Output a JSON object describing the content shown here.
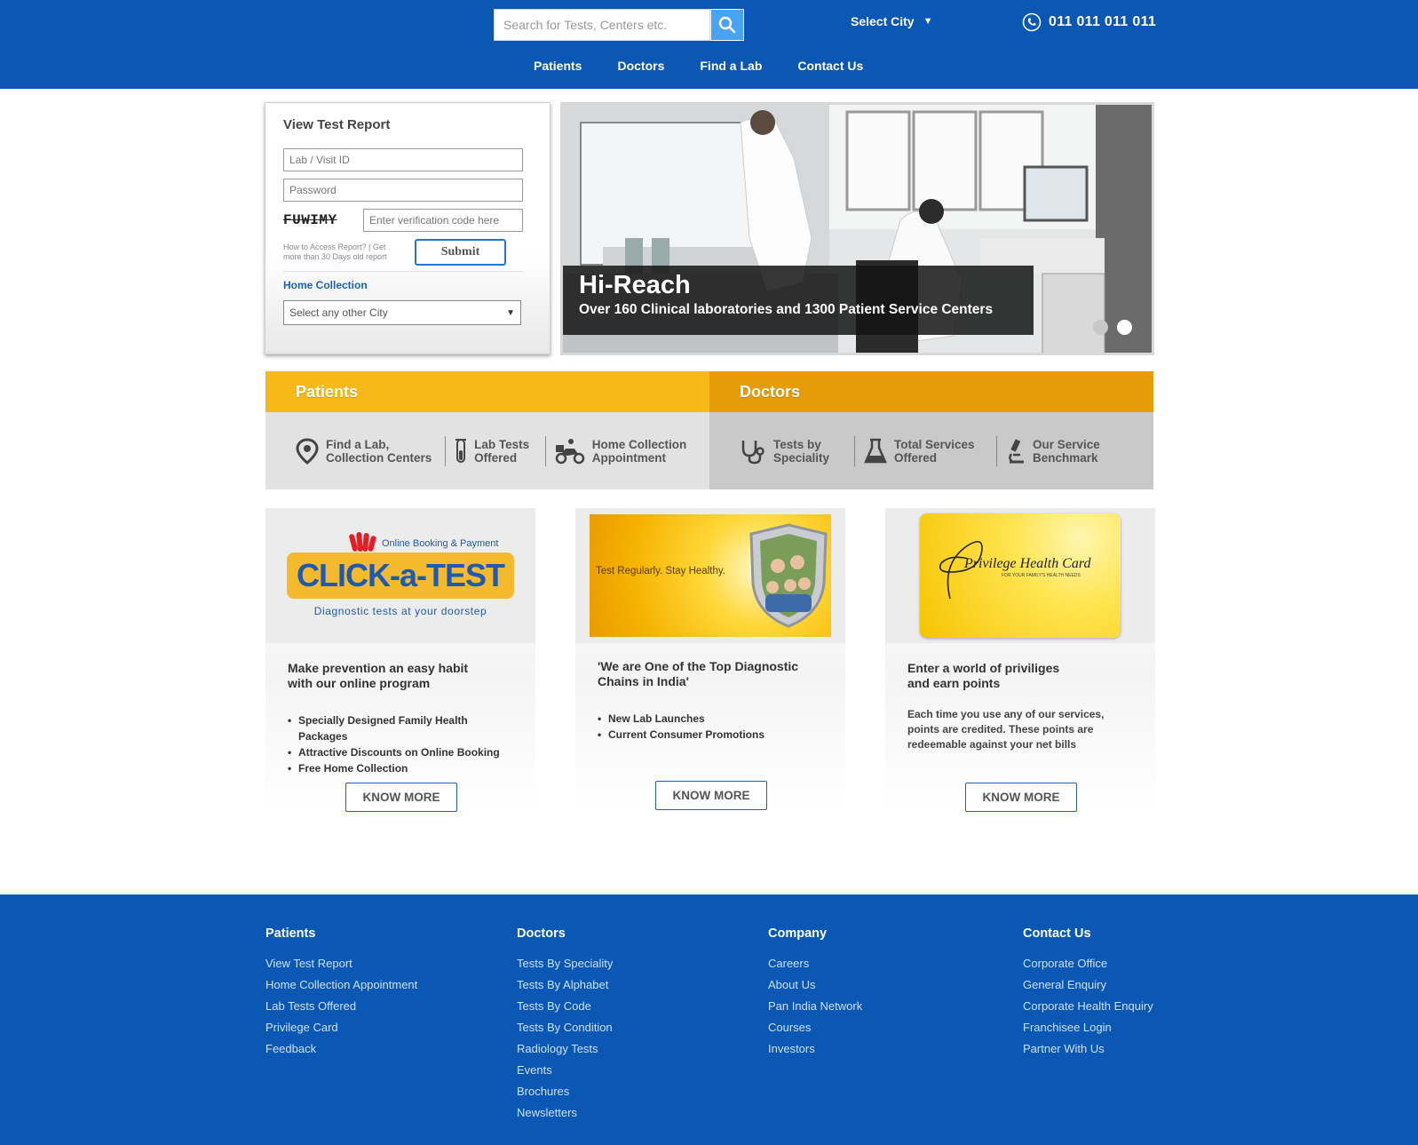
{
  "header": {
    "search_placeholder": "Search for Tests, Centers etc.",
    "city_label": "Select City",
    "phone": "011 011 011 011",
    "nav": [
      "Patients",
      "Doctors",
      "Find a Lab",
      "Contact Us"
    ]
  },
  "login": {
    "title": "View Test Report",
    "lab_id_placeholder": "Lab / Visit ID",
    "password_placeholder": "Password",
    "captcha_text": "FUWIMY",
    "captcha_placeholder": "Enter verification code here",
    "help_text": "How to Access Report? | Get more than 30 Days old report",
    "submit_label": "Submit",
    "home_collection_label": "Home Collection",
    "city_select_value": "Select any other City"
  },
  "banner": {
    "title": "Hi-Reach",
    "subtitle": "Over 160 Clinical laboratories and 1300 Patient Service Centers",
    "slides": 2,
    "active_slide": 2
  },
  "patients_band": {
    "title": "Patients",
    "items": [
      {
        "line1": "Find a Lab,",
        "line2": "Collection Centers",
        "icon": "location-pin-icon"
      },
      {
        "line1": "Lab Tests",
        "line2": "Offered",
        "icon": "test-tube-icon"
      },
      {
        "line1": "Home Collection",
        "line2": "Appointment",
        "icon": "scooter-icon"
      }
    ]
  },
  "doctors_band": {
    "title": "Doctors",
    "items": [
      {
        "line1": "Tests by",
        "line2": "Speciality",
        "icon": "stethoscope-icon"
      },
      {
        "line1": "Total Services",
        "line2": "Offered",
        "icon": "flask-icon"
      },
      {
        "line1": "Our Service",
        "line2": "Benchmark",
        "icon": "microscope-icon"
      }
    ]
  },
  "cards": [
    {
      "image_tagline": "Online Booking & Payment",
      "image_brand": "CLICK-a-TEST",
      "image_caption": "Diagnostic tests at your doorstep",
      "title_line1": "Make prevention an easy habit",
      "title_line2": "with our online program",
      "bullets": [
        "Specially Designed Family Health Packages",
        "Attractive Discounts on Online Booking",
        "Free Home Collection"
      ],
      "button": "KNOW MORE"
    },
    {
      "image_text": "Test Regularly. Stay Healthy.",
      "title_line1": "'We are One of the Top Diagnostic",
      "title_line2": "Chains in India'",
      "bullets": [
        "New Lab Launches",
        "Current Consumer Promotions"
      ],
      "button": "KNOW MORE"
    },
    {
      "image_text": "Privilege Health Card",
      "image_subtext": "FOR YOUR FAMILY'S HEALTH NEEDS",
      "title_line1": "Enter a world of priviliges",
      "title_line2": "and earn points",
      "body": "Each time you use any of our services, points are credited. These points are redeemable against your net bills",
      "button": "KNOW MORE"
    }
  ],
  "footer": {
    "patients": {
      "title": "Patients",
      "links": [
        "View Test Report",
        "Home Collection Appointment",
        "Lab Tests Offered",
        "Privilege Card",
        "Feedback"
      ]
    },
    "doctors": {
      "title": "Doctors",
      "links": [
        "Tests By Speciality",
        "Tests By Alphabet",
        "Tests By Code",
        "Tests By Condition",
        "Radiology Tests",
        "Events",
        "Brochures",
        "Newsletters"
      ]
    },
    "company": {
      "title": "Company",
      "links": [
        "Careers",
        "About Us",
        "Pan India Network",
        "Courses",
        "Investors"
      ]
    },
    "contact": {
      "title": "Contact Us",
      "links": [
        "Corporate Office",
        "General Enquiry",
        "Corporate Health Enquiry",
        "Franchisee Login",
        "Partner With Us"
      ]
    }
  },
  "colors": {
    "brand_blue": "#0a57b4",
    "patients_yellow": "#f7b918",
    "doctors_orange": "#e69b08"
  }
}
